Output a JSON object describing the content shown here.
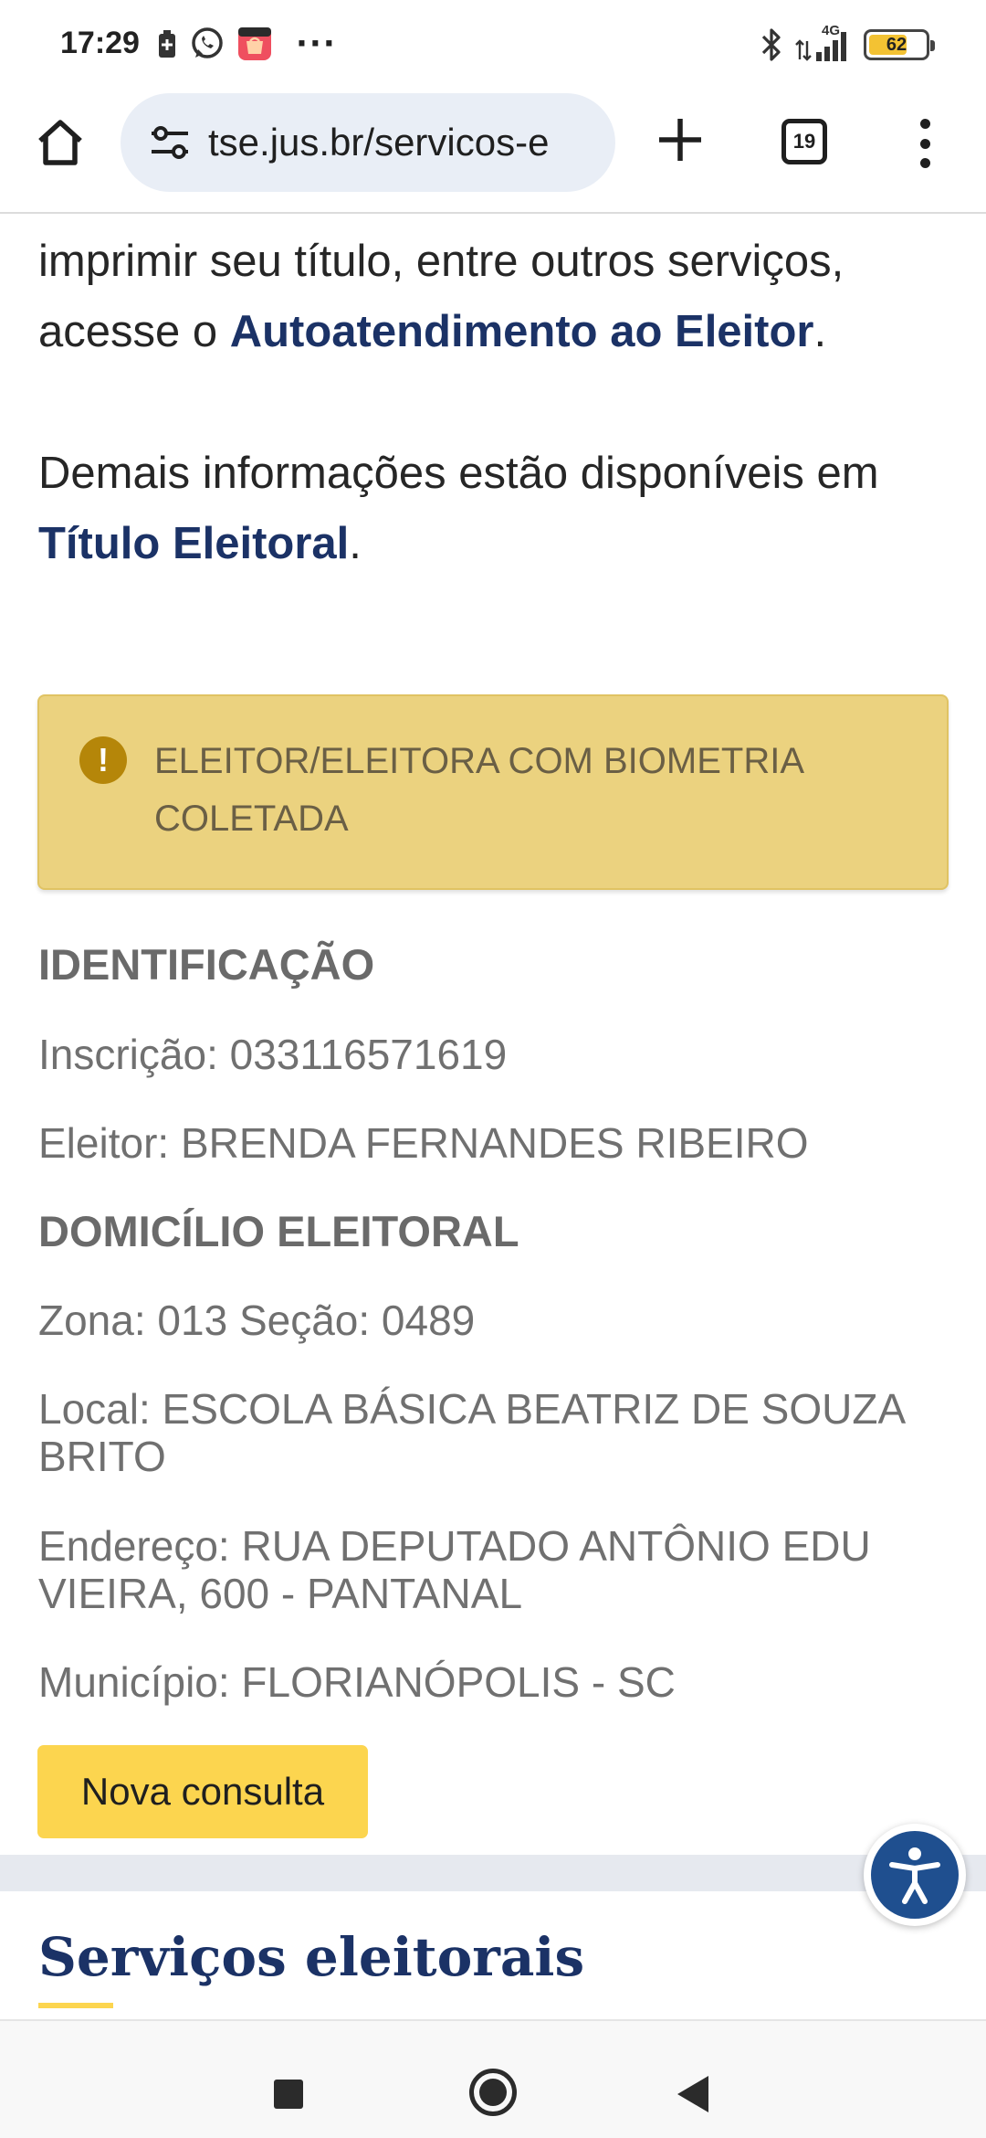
{
  "status_bar": {
    "time": "17:29",
    "battery": "62",
    "network": "4G",
    "overflow": "···",
    "icons": [
      "battery-saver-icon",
      "whatsapp-icon",
      "shopping-app-icon",
      "bluetooth-icon",
      "signal-icon",
      "battery-icon"
    ]
  },
  "browser": {
    "url": "tse.jus.br/servicos-e",
    "tab_count": "19",
    "icons": [
      "home-icon",
      "site-settings-icon",
      "new-tab-plus-icon",
      "tabs-icon",
      "more-menu-icon"
    ]
  },
  "content": {
    "para1_before": "imprimir seu título, entre outros serviços, acesse o ",
    "para1_link": "Autoatendimento ao Eleitor",
    "para1_after": ".",
    "para2_before": "Demais informações estão disponíveis em ",
    "para2_link": "Título Eleitoral",
    "para2_after": ".",
    "alert_icon": "!",
    "alert_text": "ELEITOR/ELEITORA COM BIOMETRIA COLETADA",
    "identificacao_heading": "IDENTIFICAÇÃO",
    "inscricao": "Inscrição: 033116571619",
    "eleitor": "Eleitor: BRENDA FERNANDES RIBEIRO",
    "domicilio_heading": "DOMICÍLIO ELEITORAL",
    "zona_secao": "Zona: 013 Seção: 0489",
    "local_line1": "Local: ESCOLA BÁSICA BEATRIZ DE SOUZA",
    "local_line2": "BRITO",
    "endereco_line1": "Endereço: RUA DEPUTADO ANTÔNIO EDU",
    "endereco_line2": "VIEIRA, 600 - PANTANAL",
    "municipio": "Município: FLORIANÓPOLIS - SC",
    "nova_consulta": "Nova consulta",
    "services_title": "Serviços eleitorais"
  },
  "colors": {
    "link": "#1b3266",
    "alert_bg": "#ebd27f",
    "button_bg": "#fcd54f",
    "accessibility": "#1f4f8f"
  }
}
